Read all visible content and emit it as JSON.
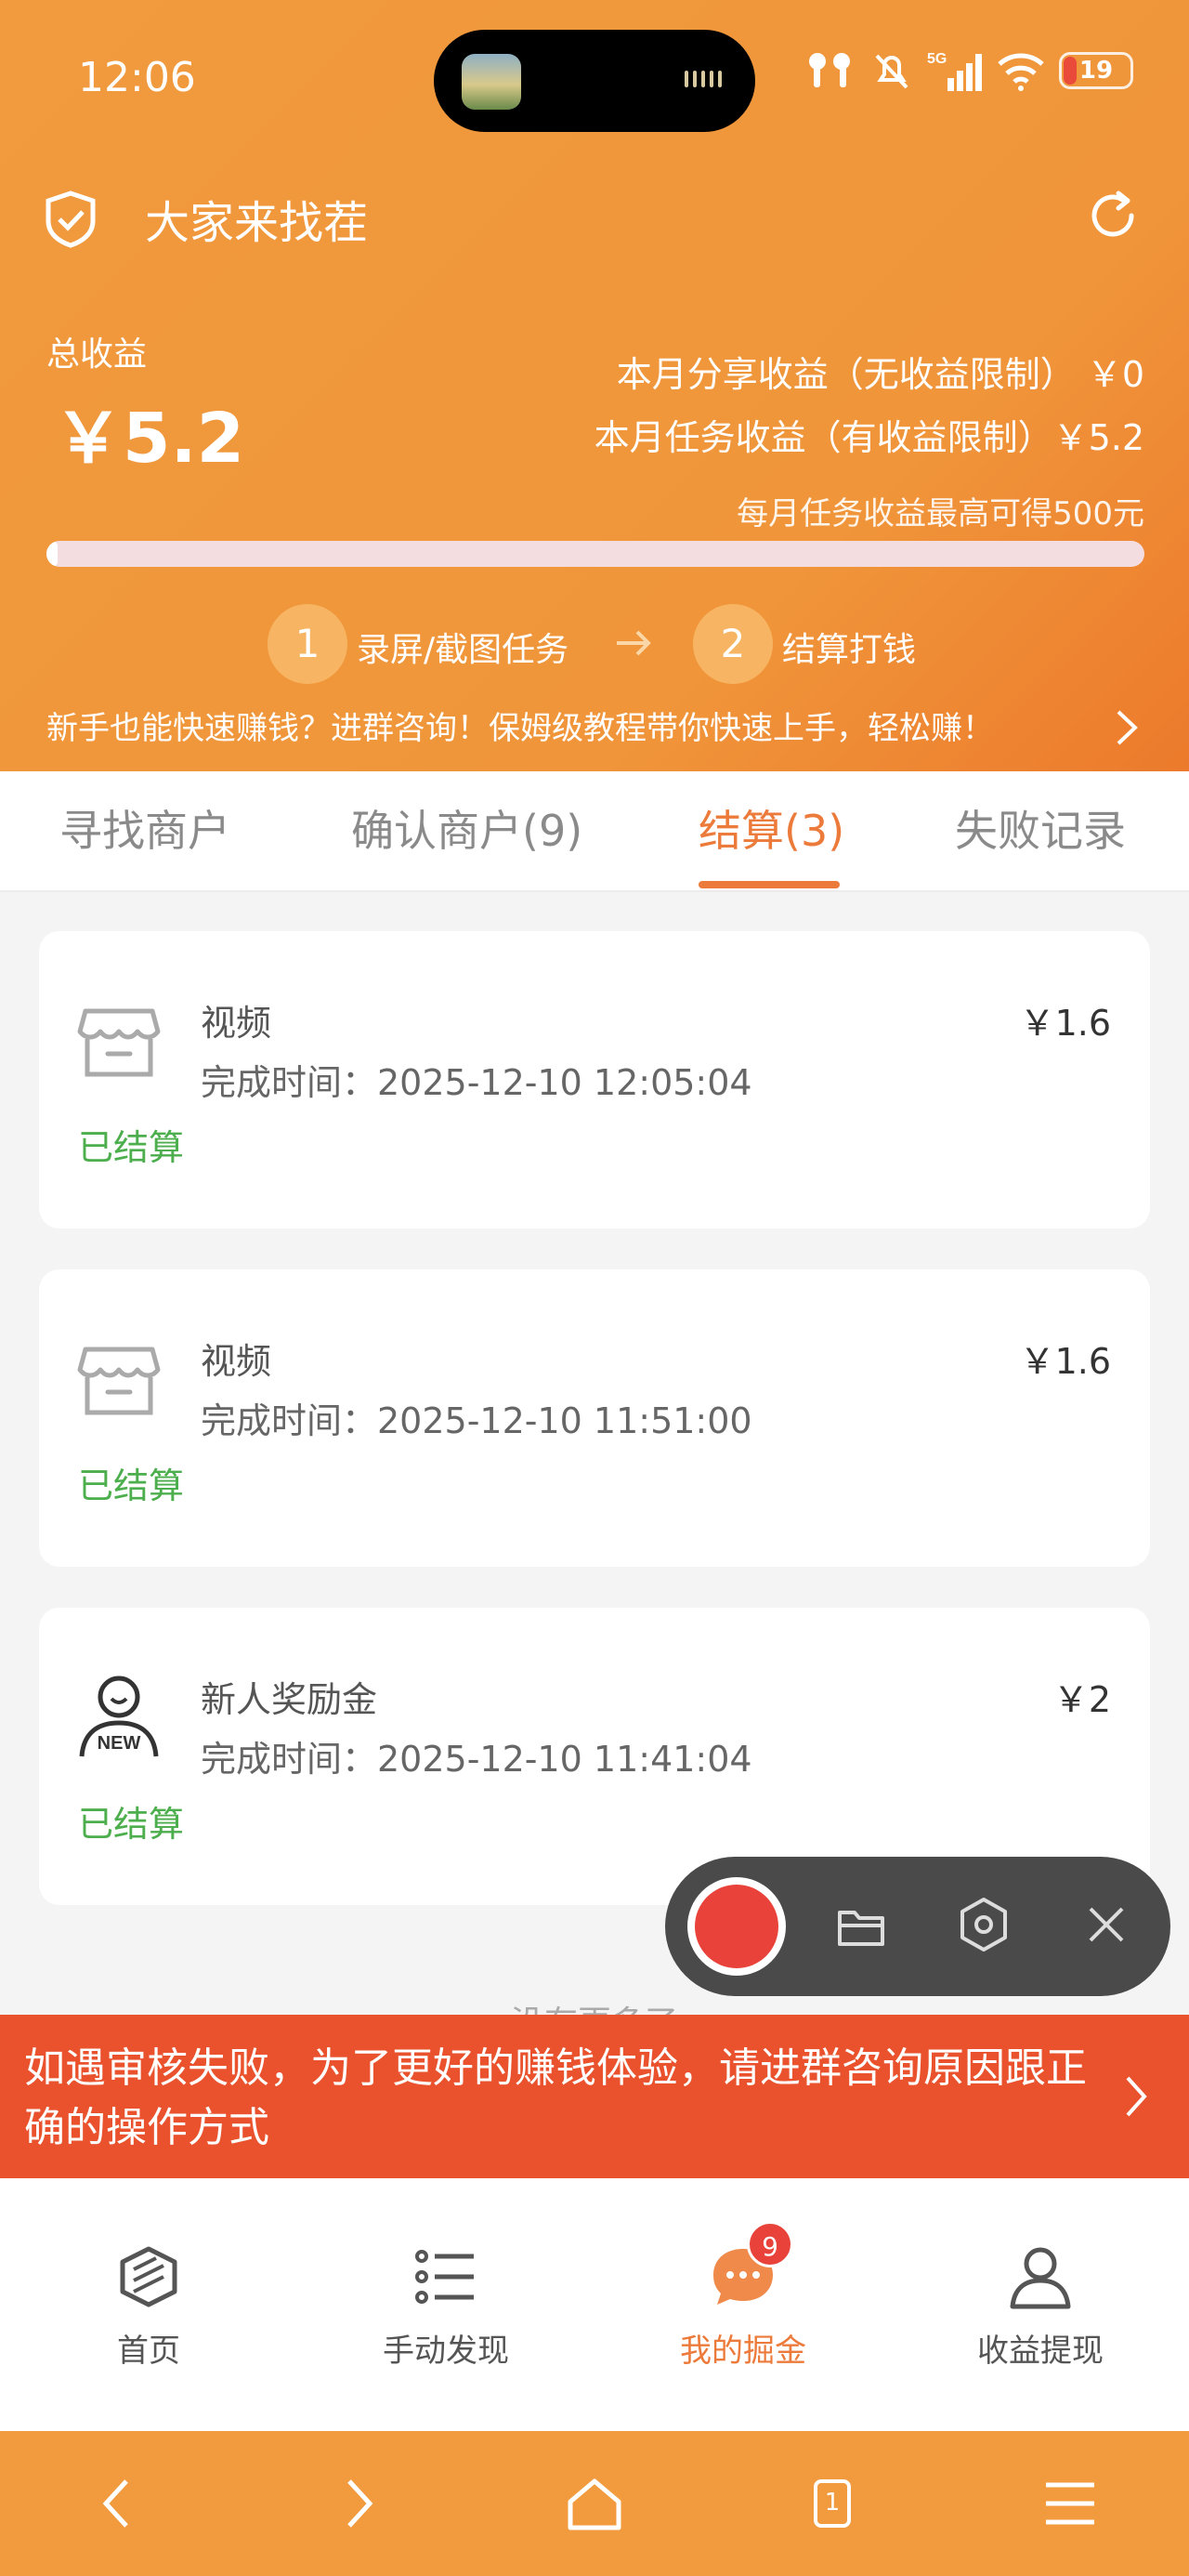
{
  "status_bar": {
    "time": "12:06",
    "battery": "19",
    "network": "5G"
  },
  "header": {
    "title": "大家来找茬",
    "total_label": "总收益",
    "total_value": "￥5.2",
    "share_income": "本月分享收益（无收益限制）  ￥0",
    "task_income": "本月任务收益（有收益限制）￥5.2",
    "cap_note": "每月任务收益最高可得500元",
    "progress_fraction": 0.0104,
    "steps": [
      {
        "num": "1",
        "label": "录屏/截图任务"
      },
      {
        "num": "2",
        "label": "结算打钱"
      }
    ],
    "notice": "新手也能快速赚钱？进群咨询！保姆级教程带你快速上手，轻松赚！"
  },
  "tabs": [
    {
      "label": "寻找商户"
    },
    {
      "label": "确认商户(9)"
    },
    {
      "label": "结算(3)",
      "active": true
    },
    {
      "label": "失败记录"
    }
  ],
  "records": [
    {
      "title": "视频",
      "time": "完成时间：2025-12-10 12:05:04",
      "amount": "￥1.6",
      "status": "已结算",
      "icon": "store-icon"
    },
    {
      "title": "视频",
      "time": "完成时间：2025-12-10 11:51:00",
      "amount": "￥1.6",
      "status": "已结算",
      "icon": "store-icon"
    },
    {
      "title": "新人奖励金",
      "time": "完成时间：2025-12-10 11:41:04",
      "amount": "￥2",
      "status": "已结算",
      "icon": "new-user-icon"
    }
  ],
  "no_more_text": "没有更多了",
  "banner": {
    "text": "如遇审核失败，为了更好的赚钱体验，请进群咨询原因跟正确的操作方式"
  },
  "bottom_nav": [
    {
      "label": "首页",
      "icon": "home-cube-icon"
    },
    {
      "label": "手动发现",
      "icon": "list-icon"
    },
    {
      "label": "我的掘金",
      "icon": "chat-icon",
      "badge": "9",
      "active": true
    },
    {
      "label": "收益提现",
      "icon": "user-icon"
    }
  ],
  "system_nav": {
    "tab_count": "1"
  },
  "colors": {
    "primary": "#f19a3e",
    "accent": "#ec7a3a",
    "success": "#4cae4c",
    "banner": "#e9522d"
  }
}
